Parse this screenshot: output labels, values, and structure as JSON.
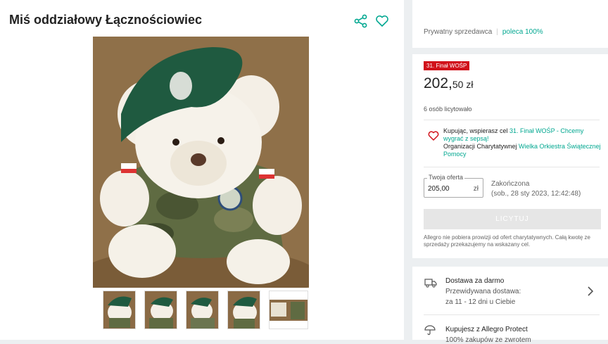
{
  "product": {
    "title": "Miś oddziałowy Łącznościowiec",
    "thumbnail_count": 5
  },
  "seller": {
    "type": "Prywatny sprzedawca",
    "recommend": "poleca 100%"
  },
  "offer": {
    "badge": "31. Finał WOŚP",
    "price_main": "202,",
    "price_cents": "50 zł",
    "bidders": "6 osób licytowało",
    "charity_prefix": "Kupując, wspierasz cel ",
    "charity_goal": "31. Finał WOŚP - Chcemy wygrać z sepsą!",
    "charity_org_prefix": "Organizacji Charytatywnej ",
    "charity_org": "Wielka Orkiestra Świątecznej Pomocy",
    "bid_label": "Twoja oferta",
    "bid_value": "205,00",
    "bid_currency": "zł",
    "status": "Zakończona",
    "ended_at": "(sob., 28 sty 2023, 12:42:48)",
    "bid_button": "LICYTUJ",
    "note": "Allegro nie pobiera prowizji od ofert charytatywnych. Całą kwotę ze sprzedaży przekazujemy na wskazany cel."
  },
  "delivery": {
    "title": "Dostawa za darmo",
    "expected_label": "Przewidywana dostawa:",
    "expected_value": "za 11 - 12 dni u Ciebie"
  },
  "protect": {
    "title": "Kupujesz z Allegro Protect",
    "subtitle": "100% zakupów ze zwrotem"
  },
  "colors": {
    "accent": "#00a790",
    "badge": "#d1121b"
  }
}
